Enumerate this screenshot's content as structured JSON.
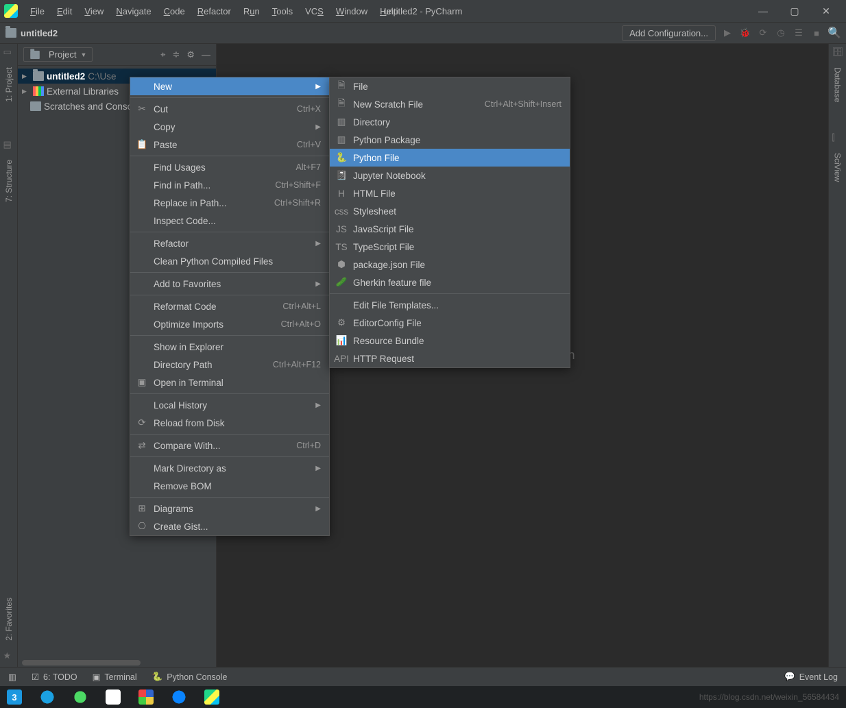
{
  "app": {
    "title": "untitled2 - PyCharm"
  },
  "menubar": {
    "items": [
      "File",
      "Edit",
      "View",
      "Navigate",
      "Code",
      "Refactor",
      "Run",
      "Tools",
      "VCS",
      "Window",
      "Help"
    ]
  },
  "breadcrumb": {
    "name": "untitled2"
  },
  "toolbar": {
    "add_config": "Add Configuration..."
  },
  "project_panel": {
    "title": "Project",
    "items": [
      {
        "name": "untitled2",
        "path": "C:\\Use",
        "selected": true
      },
      {
        "name": "External Libraries"
      },
      {
        "name": "Scratches and Consoles"
      }
    ]
  },
  "left_tabs": {
    "project": "1: Project",
    "structure": "7: Structure",
    "favorites": "2: Favorites"
  },
  "right_tabs": {
    "database": "Database",
    "sciview": "SciView"
  },
  "editor_hint": "p files here to open",
  "ctx1": {
    "groups": [
      [
        {
          "label": "New",
          "selected": true,
          "submenu": true
        }
      ],
      [
        {
          "icon": "cut",
          "label": "Cut",
          "shortcut": "Ctrl+X"
        },
        {
          "label": "Copy",
          "submenu": true
        },
        {
          "icon": "paste",
          "label": "Paste",
          "shortcut": "Ctrl+V"
        }
      ],
      [
        {
          "label": "Find Usages",
          "shortcut": "Alt+F7"
        },
        {
          "label": "Find in Path...",
          "shortcut": "Ctrl+Shift+F"
        },
        {
          "label": "Replace in Path...",
          "shortcut": "Ctrl+Shift+R"
        },
        {
          "label": "Inspect Code..."
        }
      ],
      [
        {
          "label": "Refactor",
          "submenu": true
        },
        {
          "label": "Clean Python Compiled Files"
        }
      ],
      [
        {
          "label": "Add to Favorites",
          "submenu": true
        }
      ],
      [
        {
          "label": "Reformat Code",
          "shortcut": "Ctrl+Alt+L"
        },
        {
          "label": "Optimize Imports",
          "shortcut": "Ctrl+Alt+O"
        }
      ],
      [
        {
          "label": "Show in Explorer"
        },
        {
          "label": "Directory Path",
          "shortcut": "Ctrl+Alt+F12"
        },
        {
          "icon": "terminal",
          "label": "Open in Terminal"
        }
      ],
      [
        {
          "label": "Local History",
          "submenu": true
        },
        {
          "icon": "reload",
          "label": "Reload from Disk"
        }
      ],
      [
        {
          "icon": "compare",
          "label": "Compare With...",
          "shortcut": "Ctrl+D"
        }
      ],
      [
        {
          "label": "Mark Directory as",
          "submenu": true
        },
        {
          "label": "Remove BOM"
        }
      ],
      [
        {
          "icon": "diagrams",
          "label": "Diagrams",
          "submenu": true
        },
        {
          "icon": "github",
          "label": "Create Gist..."
        }
      ]
    ]
  },
  "ctx2": {
    "groups": [
      [
        {
          "icon": "file",
          "label": "File"
        },
        {
          "icon": "scratch",
          "label": "New Scratch File",
          "shortcut": "Ctrl+Alt+Shift+Insert"
        },
        {
          "icon": "folder",
          "label": "Directory"
        },
        {
          "icon": "folder",
          "label": "Python Package"
        },
        {
          "icon": "py",
          "label": "Python File",
          "selected": true
        },
        {
          "icon": "jup",
          "label": "Jupyter Notebook"
        },
        {
          "icon": "html",
          "label": "HTML File"
        },
        {
          "icon": "css",
          "label": "Stylesheet"
        },
        {
          "icon": "js",
          "label": "JavaScript File"
        },
        {
          "icon": "ts",
          "label": "TypeScript File"
        },
        {
          "icon": "pkg",
          "label": "package.json File"
        },
        {
          "icon": "gherkin",
          "label": "Gherkin feature file"
        }
      ],
      [
        {
          "label": "Edit File Templates..."
        },
        {
          "icon": "cfg",
          "label": "EditorConfig File"
        },
        {
          "icon": "bundle",
          "label": "Resource Bundle"
        },
        {
          "icon": "api",
          "label": "HTTP Request"
        }
      ]
    ]
  },
  "status": {
    "todo": "6: TODO",
    "terminal": "Terminal",
    "python_console": "Python Console",
    "event_log": "Event Log"
  },
  "watermark": "https://blog.csdn.net/weixin_56584434"
}
